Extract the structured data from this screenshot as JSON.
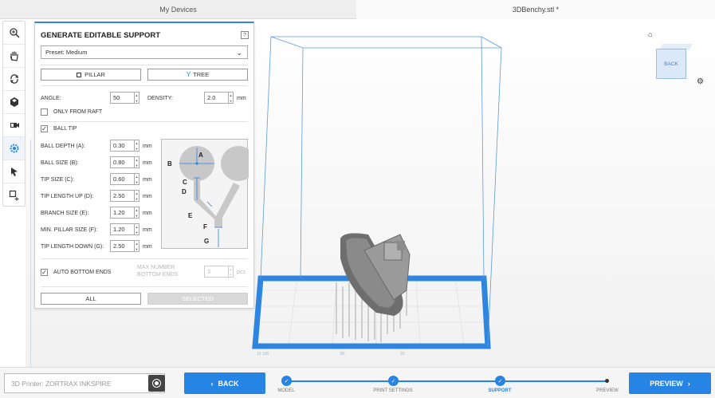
{
  "tabs": {
    "devices": "My Devices",
    "file": "3DBenchy.stl *"
  },
  "toolbar": {
    "items": [
      "zoom-icon",
      "pan-hand-icon",
      "rotate-icon",
      "cube-view-icon",
      "camera-icon",
      "support-gear-icon",
      "cursor-icon",
      "add-support-icon"
    ]
  },
  "viewcube": {
    "label": "BACK"
  },
  "panel": {
    "title": "GENERATE EDITABLE SUPPORT",
    "help": "?",
    "preset": "Preset: Medium",
    "pillar_label": "PILLAR",
    "tree_label": "TREE",
    "angle_label": "ANGLE:",
    "angle_value": "50",
    "density_label": "DENSITY:",
    "density_value": "2.0",
    "density_unit": "mm",
    "only_from_raft": "ONLY FROM RAFT",
    "ball_tip": "BALL TIP",
    "params": [
      {
        "label": "BALL DEPTH (A):",
        "value": "0.30",
        "unit": "mm"
      },
      {
        "label": "BALL SIZE (B):",
        "value": "0.80",
        "unit": "mm"
      },
      {
        "label": "TIP SIZE (C):",
        "value": "0.60",
        "unit": "mm"
      },
      {
        "label": "TIP LENGTH UP (D):",
        "value": "2.50",
        "unit": "mm"
      },
      {
        "label": "BRANCH SIZE (E):",
        "value": "1.20",
        "unit": "mm"
      },
      {
        "label": "MIN. PILLAR SIZE (F):",
        "value": "1.20",
        "unit": "mm"
      },
      {
        "label": "TIP LENGTH DOWN (G):",
        "value": "2.50",
        "unit": "mm"
      }
    ],
    "diagram_labels": {
      "a": "A",
      "b": "B",
      "c": "C",
      "d": "D",
      "e": "E",
      "f": "F",
      "g": "G"
    },
    "auto_bottom_ends": "AUTO BOTTOM ENDS",
    "max_number_line1": "MAX NUMBER",
    "max_number_line2": "BOTTOM ENDS",
    "max_number_value": "3",
    "max_number_unit": "pcs",
    "all_label": "ALL",
    "selected_label": "SELECTED"
  },
  "bottom": {
    "printer": "3D Printer: ZORTRAX INKSPIRE",
    "back": "BACK",
    "preview": "PREVIEW",
    "steps": [
      "MODEL",
      "PRINT SETTINGS",
      "SUPPORT",
      "PREVIEW"
    ]
  },
  "colors": {
    "accent": "#2684e4"
  }
}
